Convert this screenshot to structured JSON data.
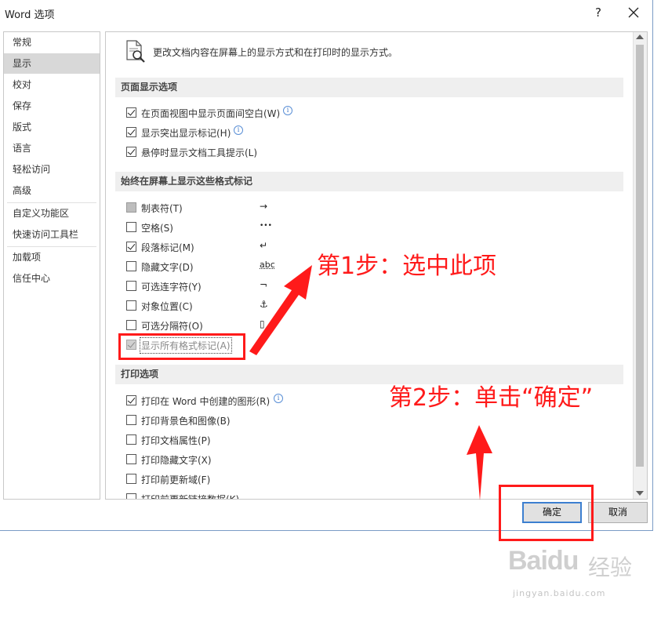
{
  "window": {
    "title": "Word 选项",
    "help_label": "?"
  },
  "sidebar": {
    "items": [
      {
        "label": "常规"
      },
      {
        "label": "显示"
      },
      {
        "label": "校对"
      },
      {
        "label": "保存"
      },
      {
        "label": "版式"
      },
      {
        "label": "语言"
      },
      {
        "label": "轻松访问"
      },
      {
        "label": "高级"
      },
      {
        "label": "自定义功能区"
      },
      {
        "label": "快速访问工具栏"
      },
      {
        "label": "加载项"
      },
      {
        "label": "信任中心"
      }
    ],
    "selected": "显示"
  },
  "main": {
    "intro": "更改文档内容在屏幕上的显示方式和在打印时的显示方式。",
    "page_display": {
      "heading": "页面显示选项",
      "options": [
        {
          "label": "在页面视图中显示页面间空白(W)",
          "checked": true
        },
        {
          "label": "显示突出显示标记(H)",
          "checked": true
        },
        {
          "label": "悬停时显示文档工具提示(L)",
          "checked": true
        }
      ]
    },
    "formatting_marks": {
      "heading": "始终在屏幕上显示这些格式标记",
      "options": [
        {
          "label": "制表符(T)",
          "symbol": "→",
          "checked": false
        },
        {
          "label": "空格(S)",
          "symbol": "•••",
          "checked": false
        },
        {
          "label": "段落标记(M)",
          "symbol": "↵",
          "checked": true
        },
        {
          "label": "隐藏文字(D)",
          "symbol": "abc",
          "checked": false
        },
        {
          "label": "可选连字符(Y)",
          "symbol": "¬",
          "checked": false
        },
        {
          "label": "对象位置(C)",
          "symbol": "⚓",
          "checked": false
        },
        {
          "label": "可选分隔符(O)",
          "symbol": "▯",
          "checked": false
        },
        {
          "label": "显示所有格式标记(A)",
          "checked": true
        }
      ]
    },
    "print": {
      "heading": "打印选项",
      "options": [
        {
          "label": "打印在 Word 中创建的图形(R)",
          "checked": true
        },
        {
          "label": "打印背景色和图像(B)",
          "checked": false
        },
        {
          "label": "打印文档属性(P)",
          "checked": false
        },
        {
          "label": "打印隐藏文字(X)",
          "checked": false
        },
        {
          "label": "打印前更新域(F)",
          "checked": false
        },
        {
          "label": "打印前更新链接数据(K)",
          "checked": false
        }
      ]
    }
  },
  "buttons": {
    "ok": "确定",
    "cancel": "取消"
  },
  "annotations": {
    "step1": "第1步：选中此项",
    "step2": "第2步：单击“确定”",
    "color": "#ff1a1a"
  },
  "watermark": {
    "brand": "Baidu",
    "name": "经验",
    "url": "jingyan.baidu.com"
  }
}
